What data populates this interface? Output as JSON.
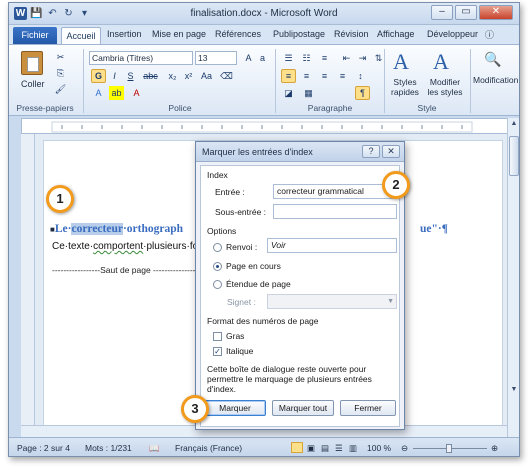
{
  "window": {
    "title": "finalisation.docx - Microsoft Word"
  },
  "qat": {
    "save": "💾",
    "undo": "↶",
    "redo": "↻",
    "custom": "▾"
  },
  "tabs": [
    {
      "label": "Fichier"
    },
    {
      "label": "Accueil"
    },
    {
      "label": "Insertion"
    },
    {
      "label": "Mise en page"
    },
    {
      "label": "Références"
    },
    {
      "label": "Publipostage"
    },
    {
      "label": "Révision"
    },
    {
      "label": "Affichage"
    },
    {
      "label": "Développeur"
    }
  ],
  "ribbon": {
    "clipboard": {
      "label": "Presse-papiers",
      "paste": "Coller"
    },
    "font": {
      "label": "Police",
      "name": "Cambria (Titres)",
      "size": "13"
    },
    "paragraph": {
      "label": "Paragraphe"
    },
    "style": {
      "label": "Style",
      "quick": "Styles rapides",
      "change": "Modifier les styles"
    },
    "editing": {
      "label": "Modification"
    }
  },
  "document": {
    "heading_pre": "Le·",
    "heading_sel": "correcteur",
    "heading_post": "·orthograph",
    "heading_tail": "ue\"·¶",
    "line2_pre": "Ce·texte·",
    "line2_err": "comportent",
    "line2_post": "·plusieurs·fo",
    "page_break": "-----------------Saut de page ----------------"
  },
  "dialog": {
    "title": "Marquer les entrées d'index",
    "help": "?",
    "close": "✕",
    "index_label": "Index",
    "entry_label": "Entrée :",
    "entry_value": "correcteur grammatical",
    "subentry_label": "Sous-entrée :",
    "subentry_value": "",
    "options_label": "Options",
    "renvoi_label": "Renvoi :",
    "renvoi_value": "Voir",
    "page_courante": "Page en cours",
    "etendue": "Étendue de page",
    "signet_label": "Signet :",
    "format_label": "Format des numéros de page",
    "gras": "Gras",
    "italique": "Italique",
    "note": "Cette boîte de dialogue reste ouverte pour permettre le marquage de plusieurs entrées d'index.",
    "marquer": "Marquer",
    "marquer_tout": "Marquer tout",
    "fermer": "Fermer"
  },
  "callouts": [
    "1",
    "2",
    "3"
  ],
  "status": {
    "page": "Page : 2 sur 4",
    "mots": "Mots : 1/231",
    "langue": "Français (France)",
    "zoom": "100 %"
  }
}
